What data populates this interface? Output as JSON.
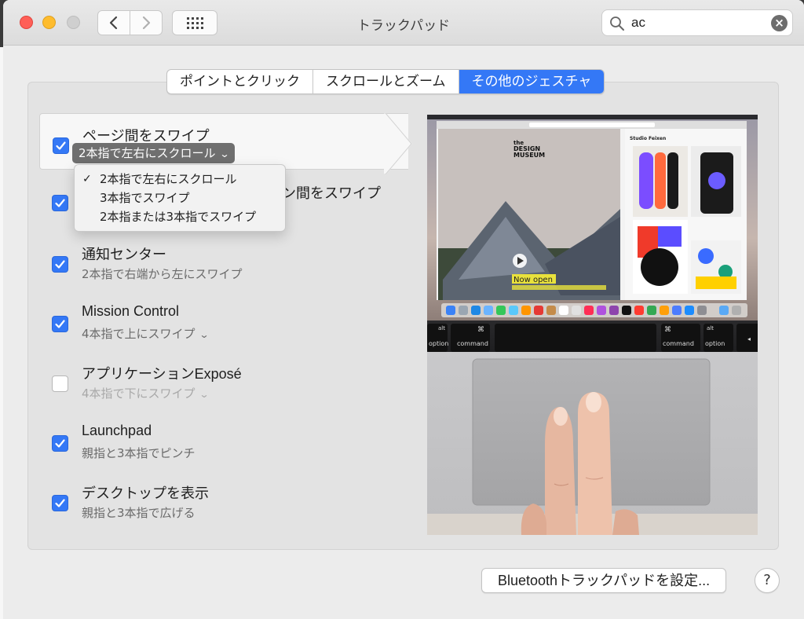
{
  "window": {
    "title": "トラックパッド"
  },
  "search": {
    "value": "ac"
  },
  "tabs": [
    {
      "label": "ポイントとクリック",
      "active": false
    },
    {
      "label": "スクロールとズーム",
      "active": false
    },
    {
      "label": "その他のジェスチャ",
      "active": true
    }
  ],
  "gestures": [
    {
      "title": "ページ間をスワイプ",
      "subtitle": "2本指で左右にスクロール",
      "checked": true,
      "has_menu": true,
      "selected": true
    },
    {
      "title": "フルスクリーンアプリケーション間をスワイプ",
      "visible_fragment": "ン間をスワイプ",
      "checked": true
    },
    {
      "title": "通知センター",
      "subtitle": "2本指で右端から左にスワイプ",
      "checked": true,
      "has_menu": false
    },
    {
      "title": "Mission Control",
      "subtitle": "4本指で上にスワイプ",
      "checked": true,
      "has_menu": true
    },
    {
      "title": "アプリケーションExposé",
      "subtitle": "4本指で下にスワイプ",
      "checked": false,
      "has_menu": true,
      "disabled": true
    },
    {
      "title": "Launchpad",
      "subtitle": "親指と3本指でピンチ",
      "checked": true,
      "has_menu": false
    },
    {
      "title": "デスクトップを表示",
      "subtitle": "親指と3本指で広げる",
      "checked": true,
      "has_menu": false
    }
  ],
  "dropdown_menu": {
    "items": [
      {
        "label": "2本指で左右にスクロール",
        "checked": true
      },
      {
        "label": "3本指でスワイプ",
        "checked": false
      },
      {
        "label": "2本指または3本指でスワイプ",
        "checked": false
      }
    ]
  },
  "preview": {
    "website": {
      "brand_line1": "the",
      "brand_line2": "DESIGN",
      "brand_line3": "MUSEUM",
      "panel_title": "Studio Feixen",
      "banner": "Now open"
    },
    "keys": {
      "left_alt": "alt",
      "left_option": "option",
      "cmd_symbol": "⌘",
      "cmd": "command",
      "right_alt": "alt",
      "right_option": "option"
    }
  },
  "footer": {
    "bluetooth_button": "Bluetoothトラックパッドを設定...",
    "help_button": "?"
  },
  "colors": {
    "accent": "#3478f6",
    "close": "#ff5f57",
    "minimize": "#febc2e",
    "zoom": "#cfcfcf"
  }
}
